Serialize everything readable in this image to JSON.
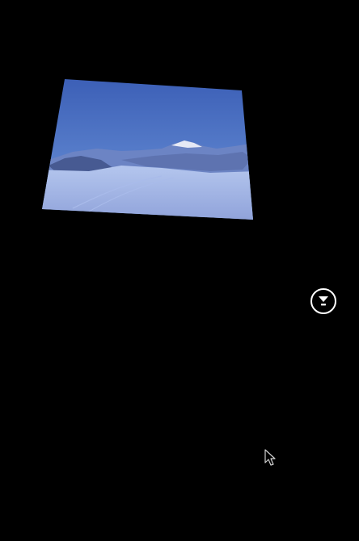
{
  "scene": {
    "background_color": "#000000",
    "photo": {
      "subject": "snowy-mountain-landscape",
      "sky_top_color": "#3f63b8",
      "sky_bottom_color": "#7aa0dc",
      "snow_color": "#9fb4e6",
      "mountain_shadow_color": "#4a5f9a"
    },
    "mode_button": {
      "icon": "filter-icon",
      "ring_color": "#ffffff"
    },
    "cursor": {
      "icon": "pointer-cursor-icon"
    }
  }
}
